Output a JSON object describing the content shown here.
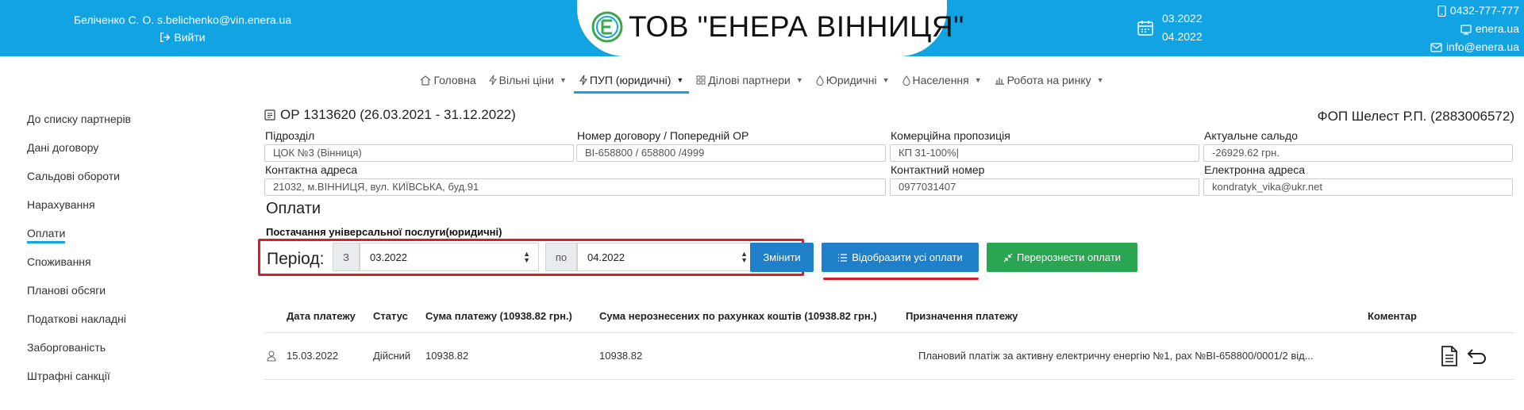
{
  "header": {
    "user_name": "Беліченко С. О. s.belichenko@vin.enera.ua",
    "logout_label": "Вийти",
    "company_title": "ТОВ \"ЕНЕРА ВІННИЦЯ\"",
    "period_from": "03.2022",
    "period_to": "04.2022",
    "phone": "0432-777-777",
    "site": "enera.ua",
    "email": "info@enera.ua",
    "brand_color": "#12a3e3"
  },
  "nav": {
    "items": [
      {
        "label": "Головна",
        "icon": "home-icon"
      },
      {
        "label": "Вільні ціни",
        "icon": "bolt-icon"
      },
      {
        "label": "ПУП (юридичні)",
        "icon": "bolt-icon"
      },
      {
        "label": "Ділові партнери",
        "icon": "grid-icon"
      },
      {
        "label": "Юридичні",
        "icon": "drop-icon"
      },
      {
        "label": "Населення",
        "icon": "drop-icon"
      },
      {
        "label": "Робота на ринку",
        "icon": "chart-icon"
      }
    ],
    "active": "ПУП (юридичні)"
  },
  "sidebar": {
    "items": [
      "До списку партнерів",
      "Дані договору",
      "Сальдові обороти",
      "Нарахування",
      "Оплати",
      "Споживання",
      "Планові обсяги",
      "Податкові накладні",
      "Заборгованість",
      "Штрафні санкції"
    ],
    "active": "Оплати"
  },
  "contract": {
    "title": "ОР 1313620 (26.03.2021 - 31.12.2022)",
    "client": "ФОП Шелест Р.П. (2883006572)",
    "fields": {
      "subdivision_label": "Підрозділ",
      "subdivision_value": "ЦОК №3 (Вінниця)",
      "contract_label": "Номер договору / Попередній ОР",
      "contract_value": "ВІ-658800 / 658800 /4999",
      "offer_label": "Комерційна пропозиція",
      "offer_value": "КП 31-100%|",
      "balance_label": "Актуальне сальдо",
      "balance_value": "-26929.62 грн.",
      "address_label": "Контактна адреса",
      "address_value": "21032, м.ВІННИЦЯ, вул. КИЇВСЬКА, буд.91",
      "phone_label": "Контактний номер",
      "phone_value": "0977031407",
      "email_label": "Електронна адреса",
      "email_value": "kondratyk_vika@ukr.net"
    }
  },
  "payments": {
    "section_title": "Оплати",
    "sub_title": "Постачання універсальної послуги(юридичні)",
    "period_label": "Період:",
    "from_addon": "З",
    "from_value": "03.2022",
    "to_addon": "по",
    "to_value": "04.2022",
    "change_button": "Змінити",
    "show_all_button": "Відобразити усі оплати",
    "transfer_button": "Перерознести оплати",
    "columns": [
      "Дата платежу",
      "Статус",
      "Сума платежу (10938.82 грн.)",
      "Сума нерознесених по рахунках коштів (10938.82 грн.)",
      "Призначення платежу",
      "Коментар"
    ],
    "rows": [
      {
        "date": "15.03.2022",
        "status": "Дійсний",
        "amount": "10938.82",
        "unallocated": "10938.82",
        "purpose": "Плановий платіж за активну електричну енергію №1, рах №ВІ-658800/0001/2 від...",
        "comment": ""
      }
    ]
  }
}
